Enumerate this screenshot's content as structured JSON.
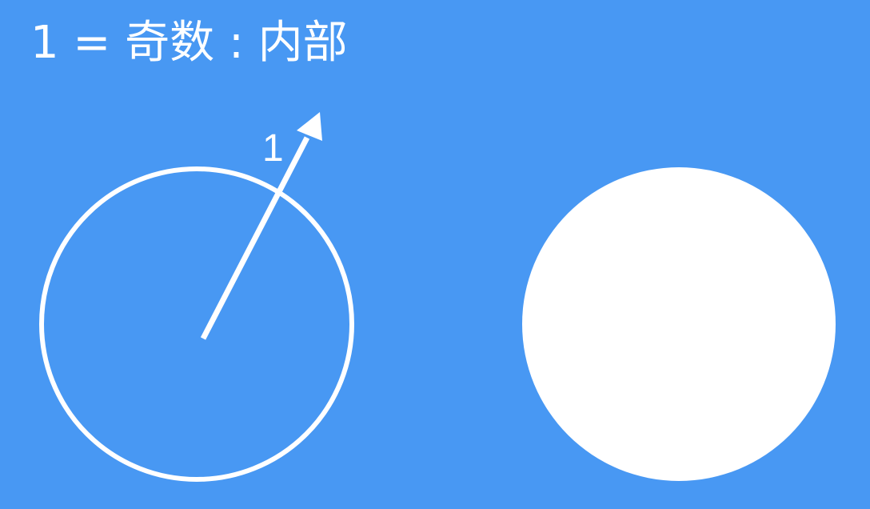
{
  "title": "1 = 奇数 : 内部",
  "ray": {
    "label": "1"
  },
  "colors": {
    "background": "#4898F3",
    "foreground": "#FFFFFF"
  }
}
